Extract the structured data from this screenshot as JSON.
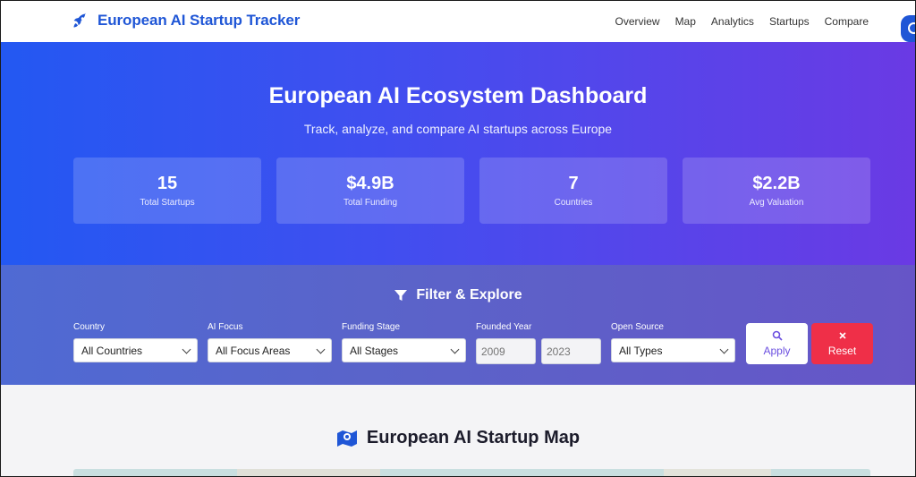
{
  "nav": {
    "brand": "European AI Startup Tracker",
    "links": [
      "Overview",
      "Map",
      "Analytics",
      "Startups",
      "Compare"
    ]
  },
  "hero": {
    "title": "European AI Ecosystem Dashboard",
    "subtitle": "Track, analyze, and compare AI startups across Europe",
    "stats": [
      {
        "value": "15",
        "label": "Total Startups"
      },
      {
        "value": "$4.9B",
        "label": "Total Funding"
      },
      {
        "value": "7",
        "label": "Countries"
      },
      {
        "value": "$2.2B",
        "label": "Avg Valuation"
      }
    ]
  },
  "filter": {
    "title": "Filter & Explore",
    "country": {
      "label": "Country",
      "value": "All Countries"
    },
    "focus": {
      "label": "AI Focus",
      "value": "All Focus Areas"
    },
    "stage": {
      "label": "Funding Stage",
      "value": "All Stages"
    },
    "year": {
      "label": "Founded Year",
      "from_placeholder": "2009",
      "to_placeholder": "2023"
    },
    "open_source": {
      "label": "Open Source",
      "value": "All Types"
    },
    "apply_label": "Apply",
    "reset_label": "Reset"
  },
  "map": {
    "title": "European AI Startup Map"
  },
  "colors": {
    "brand": "#1f56d6",
    "reset": "#ef2f48",
    "apply_text": "#6b4fe0"
  },
  "icons": {
    "brand": "rocket-icon",
    "filter": "filter-funnel-icon",
    "apply": "search-icon",
    "reset": "close-icon",
    "map": "map-marker-icon"
  }
}
